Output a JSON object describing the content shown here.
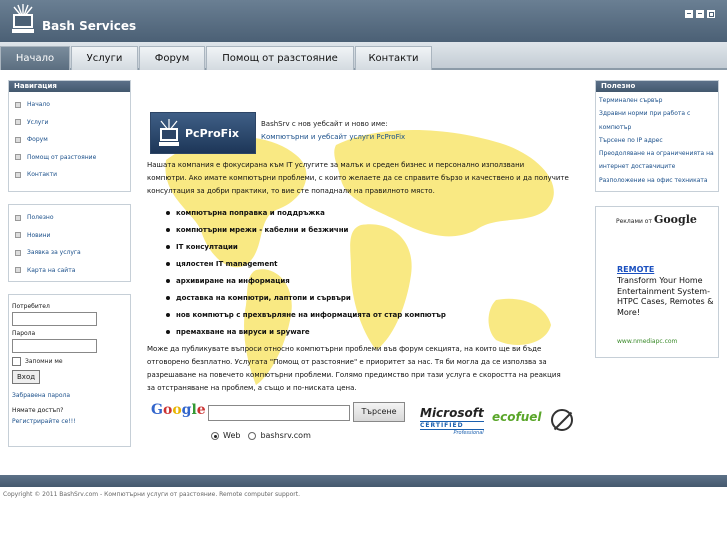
{
  "brand": {
    "name": "Bash Services"
  },
  "nav": {
    "tabs": [
      {
        "label": "Начало"
      },
      {
        "label": "Услуги"
      },
      {
        "label": "Форум"
      },
      {
        "label": "Помощ от разстояние"
      },
      {
        "label": "Контакти"
      }
    ]
  },
  "navigation": {
    "title": "Навигация",
    "items": [
      {
        "label": "Начало"
      },
      {
        "label": "Услуги"
      },
      {
        "label": "Форум"
      },
      {
        "label": "Помощ от разстояние"
      },
      {
        "label": "Контакти"
      }
    ]
  },
  "links": {
    "items": [
      {
        "label": "Полезно"
      },
      {
        "label": "Новини"
      },
      {
        "label": "Заявка за услуга"
      },
      {
        "label": "Карта на сайта"
      }
    ]
  },
  "login": {
    "user_label": "Потребител",
    "pass_label": "Парола",
    "remember_label": "Запомни ме",
    "submit_label": "Вход",
    "forgot_label": "Забравена парола",
    "no_account_label": "Нямате достъп?",
    "register_label": "Регистрирайте се!!!"
  },
  "main": {
    "banner_text": "PcProFix",
    "intro_line1": "BashSrv с нов уебсайт и ново име:",
    "intro_line2": "Компютърни и уебсайт услуги PcProFix",
    "para1_l1": "Нашата компания е фокусирана към IT услугите за малък и среден бизнес и персонално използвани",
    "para1_l2": "компютри. Ако имате компютърни проблеми, с които желаете да се справите бързо и качествено и да получите",
    "para1_l3": "консултация за добри практики, то вие сте попаднали на правилното място.",
    "bullets": [
      "компютърна поправка и поддръжка",
      "компютърни мрежи - кабелни и безжични",
      "IT консултации",
      "цялостен IT management",
      "архивиране на информация",
      "доставка на компютри, лаптопи и сървъри",
      "нов компютър с прехвърляне на информацията от стар компютър",
      "премахване на вируси и spyware"
    ],
    "para2_l1": "Може да публикувате въпроси относно компютърни проблеми във форум секцията, на които ще ви бъде",
    "para2_l2": "отговорено безплатно. Услугата \"Помощ от разстояние\" е приоритет за нас. Тя би могла да се използва за",
    "para2_l3": "разрешаване на повечето компютърни проблеми. Голямо предимство при тази услуга е скоростта на реакция",
    "para2_l4": "за отстраняване на проблем, а също и по-ниската цена."
  },
  "search": {
    "logo_text": "Google",
    "button_label": "Търсене",
    "option_web": "Web",
    "option_site": "bashsrv.com"
  },
  "badges": {
    "ms_title": "Microsoft",
    "ms_cert": "CERTIFIED",
    "ms_pro": "Professional",
    "ecofuel": "ecofuel"
  },
  "useful": {
    "title": "Полезно",
    "items": [
      {
        "label": "Терминален сървър"
      },
      {
        "label": "Здравни норми при работа с"
      },
      {
        "label": "компютър"
      },
      {
        "label": "Търсене по IP адрес"
      },
      {
        "label": "Преодоляване на ограниченията на"
      },
      {
        "label": "интернет доставчиците"
      },
      {
        "label": "Разположение на офис техниката"
      }
    ]
  },
  "ad": {
    "prefix": "Реклами от",
    "google": "Google",
    "title": "REMOTE",
    "body": "Transform Your Home Entertainment System- HTPC Cases, Remotes & More!",
    "url": "www.nmediapc.com"
  },
  "footer": {
    "text": "Copyright © 2011 BashSrv.com - Компютърни услуги от разстояние. Remote computer support."
  },
  "colors": {
    "header": "#4b6075",
    "accent_link": "#1a4f8a",
    "map_yellow": "#f7e25a"
  }
}
